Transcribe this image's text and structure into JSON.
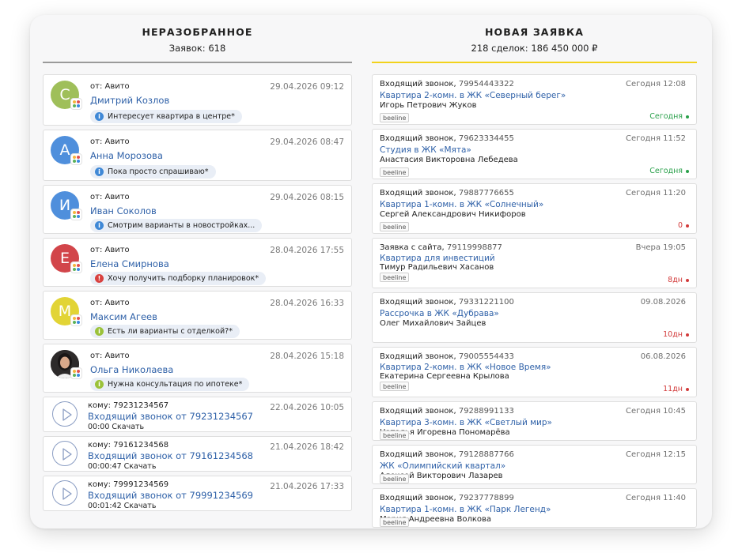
{
  "left": {
    "title": "НЕРАЗОБРАННОЕ",
    "subtitle": "Заявок: 618",
    "leads": [
      {
        "letter": "С",
        "color": "#9fbf5a",
        "from": "от: Авито",
        "date": "29.04.2026 09:12",
        "name": "Дмитрий Козлов",
        "note": "Интересует квартира в центре*",
        "note_icon": "info-icon",
        "note_color": "blue"
      },
      {
        "letter": "А",
        "color": "#4f8fdc",
        "from": "от: Авито",
        "date": "29.04.2026 08:47",
        "name": "Анна Морозова",
        "note": "Пока просто спрашиваю*",
        "note_icon": "info-icon",
        "note_color": "blue"
      },
      {
        "letter": "И",
        "color": "#4f8fdc",
        "from": "от: Авито",
        "date": "29.04.2026 08:15",
        "name": "Иван Соколов",
        "note": "Смотрим варианты в новостройках...",
        "note_icon": "info-icon",
        "note_color": "blue"
      },
      {
        "letter": "Е",
        "color": "#d2454a",
        "from": "от: Авито",
        "date": "28.04.2026 17:55",
        "name": "Елена Смирнова",
        "note": "Хочу получить подборку планировок*",
        "note_icon": "alert-icon",
        "note_color": "red"
      },
      {
        "letter": "М",
        "color": "#e2d435",
        "from": "от: Авито",
        "date": "28.04.2026 16:33",
        "name": "Максим Агеев",
        "note": "Есть ли варианты с отделкой?*",
        "note_icon": "info-icon",
        "note_color": "green"
      },
      {
        "letter": "",
        "color": "#2d2a2a",
        "photo": true,
        "from": "от: Авито",
        "date": "28.04.2026 15:18",
        "name": "Ольга Николаева",
        "note": "Нужна консультация по ипотеке*",
        "note_icon": "info-icon",
        "note_color": "green"
      }
    ],
    "calls": [
      {
        "to": "кому: 79231234567",
        "date": "22.04.2026 10:05",
        "link": "Входящий звонок от 79231234567",
        "duration": "00:00",
        "download": "Скачать"
      },
      {
        "to": "кому: 79161234568",
        "date": "21.04.2026 18:42",
        "link": "Входящий звонок от 79161234568",
        "duration": "00:00:47",
        "download": "Скачать"
      },
      {
        "to": "кому: 79991234569",
        "date": "21.04.2026 17:33",
        "link": "Входящий звонок от 79991234569",
        "duration": "00:01:42",
        "download": "Скачать"
      }
    ]
  },
  "right": {
    "title": "НОВАЯ ЗАЯВКА",
    "subtitle": "218 сделок: 186 450 000 ₽",
    "deals": [
      {
        "type": "Входящий звонок,",
        "phone": "79954443322",
        "date": "Сегодня 12:08",
        "title": "Квартира 2-комн. в ЖК «Северный берег»",
        "person": "Игорь Петрович Жуков",
        "tag": "beeline",
        "status": "Сегодня",
        "status_color": "green"
      },
      {
        "type": "Входящий звонок,",
        "phone": "79623334455",
        "date": "Сегодня 11:52",
        "title": "Студия в ЖК «Мята»",
        "person": "Анастасия Викторовна Лебедева",
        "tag": "beeline",
        "status": "Сегодня",
        "status_color": "green"
      },
      {
        "type": "Входящий звонок,",
        "phone": "79887776655",
        "date": "Сегодня 11:20",
        "title": "Квартира 1-комн. в ЖК «Солнечный»",
        "person": "Сергей Александрович Никифоров",
        "tag": "beeline",
        "status": "0",
        "status_color": "red"
      },
      {
        "type": "Заявка с сайта,",
        "phone": "79119998877",
        "date": "Вчера 19:05",
        "title": "Квартира для инвестиций",
        "person": "Тимур Радильевич Хасанов",
        "tag": "beeline",
        "status": "8дн",
        "status_color": "red",
        "tight": true
      },
      {
        "type": "Входящий звонок,",
        "phone": "79331221100",
        "date": "09.08.2026",
        "title": "Рассрочка в ЖК «Дубрава»",
        "person": "Олег Михайлович Зайцев",
        "tag": "",
        "status": "10дн",
        "status_color": "red"
      },
      {
        "type": "Входящий звонок,",
        "phone": "79005554433",
        "date": "06.08.2026",
        "title": "Квартира 2-комн. в ЖК «Новое Время»",
        "person": "Екатерина Сергеевна Крылова",
        "tag": "beeline",
        "status": "11дн",
        "status_color": "red",
        "tight": true
      },
      {
        "type": "Входящий звонок,",
        "phone": "79288991133",
        "date": "Сегодня 10:45",
        "title": "Квартира 3-комн. в ЖК «Светлый мир»",
        "person": "Наталья Игоревна Пономарёва",
        "tag": "beeline",
        "status": "",
        "status_color": "",
        "short": true
      },
      {
        "type": "Входящий звонок,",
        "phone": "79128887766",
        "date": "Сегодня 12:15",
        "title": "ЖК «Олимпийский квартал»",
        "person": "Алексей Викторович Лазарев",
        "tag": "beeline",
        "status": "",
        "status_color": "",
        "short": true
      },
      {
        "type": "Входящий звонок,",
        "phone": "79237778899",
        "date": "Сегодня 11:40",
        "title": "Квартира 1-комн. в ЖК «Парк Легенд»",
        "person": "Мария Андреевна Волкова",
        "tag": "beeline",
        "status": "",
        "status_color": "",
        "short": true
      }
    ]
  }
}
